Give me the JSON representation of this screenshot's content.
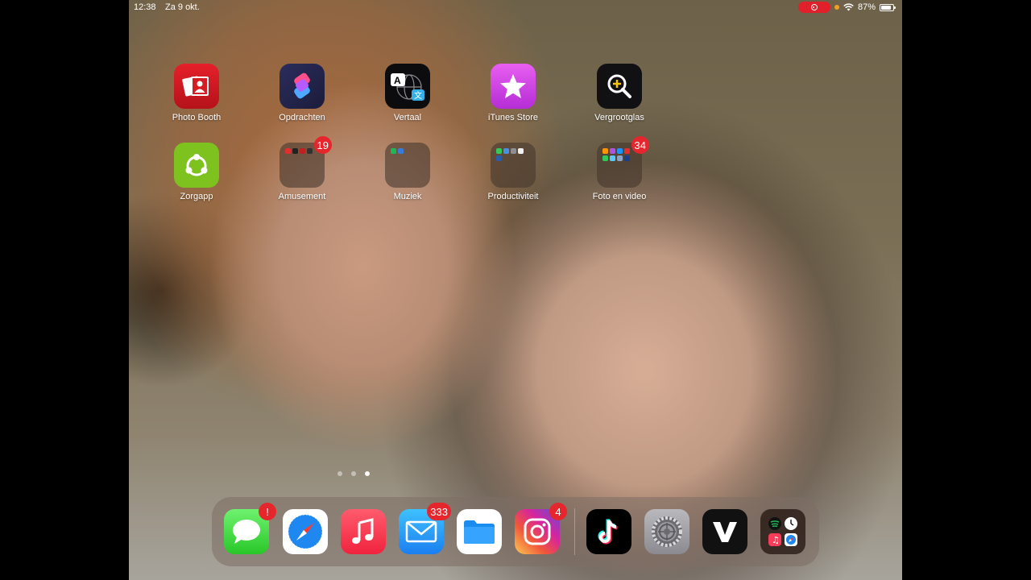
{
  "status_bar": {
    "time": "12:38",
    "date": "Za 9 okt.",
    "battery": "87%",
    "battery_level": 0.87,
    "recording_color": "#e0202a"
  },
  "home": {
    "apps": [
      {
        "name": "Photo Booth",
        "icon": "photo-booth-icon"
      },
      {
        "name": "Opdrachten",
        "icon": "shortcuts-icon"
      },
      {
        "name": "Vertaal",
        "icon": "translate-icon"
      },
      {
        "name": "iTunes Store",
        "icon": "star-icon"
      },
      {
        "name": "Vergrootglas",
        "icon": "magnifier-icon"
      },
      {
        "name": "Zorgapp",
        "icon": "zorgapp-icon"
      }
    ],
    "folders": [
      {
        "name": "Amusement",
        "badge": "19"
      },
      {
        "name": "Muziek"
      },
      {
        "name": "Productiviteit"
      },
      {
        "name": "Foto en video",
        "badge": "34"
      }
    ]
  },
  "page_dots": {
    "count": 3,
    "active": 3
  },
  "dock": {
    "apps": [
      {
        "name": "messages-app",
        "icon": "speech-bubble-icon",
        "badge": "!"
      },
      {
        "name": "safari-app",
        "icon": "compass-icon"
      },
      {
        "name": "music-app",
        "icon": "music-note-icon"
      },
      {
        "name": "mail-app",
        "icon": "envelope-icon",
        "badge": "333"
      },
      {
        "name": "files-app",
        "icon": "folder-icon"
      },
      {
        "name": "instagram-app",
        "icon": "camera-icon",
        "badge": "4"
      },
      {
        "name": "tiktok-app",
        "icon": "tiktok-icon"
      },
      {
        "name": "settings-app",
        "icon": "gear-icon"
      },
      {
        "name": "vivino-app",
        "icon": "v-logo-icon"
      },
      {
        "name": "recent-apps",
        "icon": "app-library-icon"
      }
    ]
  }
}
